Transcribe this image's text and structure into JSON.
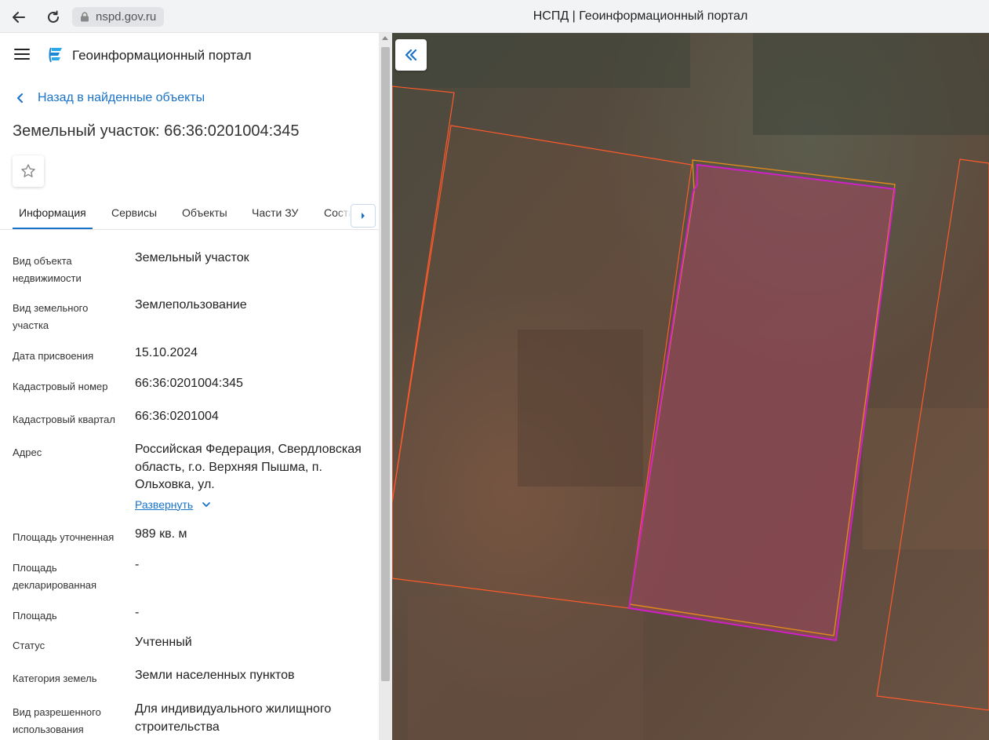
{
  "browser": {
    "url": "nspd.gov.ru",
    "tab_title": "НСПД | Геоинформационный портал"
  },
  "header": {
    "portal_name": "Геоинформационный портал"
  },
  "navigation": {
    "back_label": "Назад в найденные объекты"
  },
  "object": {
    "title": "Земельный участок: 66:36:0201004:345"
  },
  "tabs": [
    {
      "label": "Информация",
      "active": true
    },
    {
      "label": "Сервисы",
      "active": false
    },
    {
      "label": "Объекты",
      "active": false
    },
    {
      "label": "Части ЗУ",
      "active": false
    },
    {
      "label": "Соста",
      "active": false
    }
  ],
  "info": [
    {
      "label": "Вид объекта недвижимости",
      "value": "Земельный участок"
    },
    {
      "label": "Вид земельного участка",
      "value": "Землепользование"
    },
    {
      "label": "Дата присвоения",
      "value": "15.10.2024"
    },
    {
      "label": "Кадастровый номер",
      "value": "66:36:0201004:345"
    },
    {
      "label": "Кадастровый квартал",
      "value": "66:36:0201004"
    },
    {
      "label": "Адрес",
      "value": "Российская Федерация, Свердловская область, г.о. Верхняя Пышма, п. Ольховка, ул.",
      "expand_label": "Развернуть"
    },
    {
      "label": "Площадь уточненная",
      "value": "989 кв. м"
    },
    {
      "label": "Площадь декларированная",
      "value": "-"
    },
    {
      "label": "Площадь",
      "value": "-"
    },
    {
      "label": "Статус",
      "value": "Учтенный"
    },
    {
      "label": "Категория земель",
      "value": "Земли населенных пунктов"
    },
    {
      "label": "Вид разрешенного использования",
      "value": "Для индивидуального жилищного строительства"
    }
  ],
  "map": {
    "parcel_outline_color": "#ff5a2a",
    "selected_fill_color": "#a0475f",
    "selected_outline_color": "#d020c8",
    "selected_inner_outline_color": "#e0891c"
  },
  "icons": {
    "back": "arrow-left-icon",
    "reload": "reload-icon",
    "lock": "lock-icon",
    "menu": "hamburger-menu-icon",
    "logo": "portal-logo-icon",
    "favorite": "star-outline-icon",
    "collapse": "double-chevron-left-icon"
  }
}
